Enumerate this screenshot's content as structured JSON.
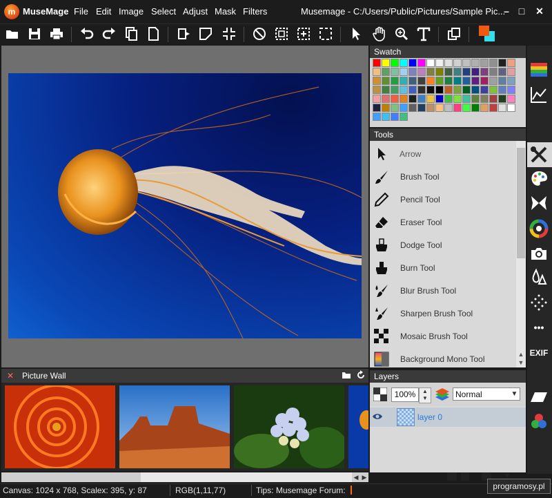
{
  "app": {
    "name": "MuseMage",
    "logo_letter": "m",
    "window_title": "Musemage - C:/Users/Public/Pictures/Sample Pic..."
  },
  "menu": [
    {
      "label": "File"
    },
    {
      "label": "Edit"
    },
    {
      "label": "Image"
    },
    {
      "label": "Select"
    },
    {
      "label": "Adjust"
    },
    {
      "label": "Mask"
    },
    {
      "label": "Filters"
    }
  ],
  "window_controls": {
    "minimize": "–",
    "maximize": "□",
    "close": "✕"
  },
  "toolbar": {
    "icons": [
      "open-folder-icon",
      "save-icon",
      "print-icon",
      "undo-icon",
      "redo-icon",
      "copy-icon",
      "paste-icon",
      "rotate-icon",
      "transform-icon",
      "crop-icon",
      "deselect-icon",
      "select-rect-icon",
      "select-all-icon",
      "select-dashed-icon",
      "arrow-cursor-icon",
      "hand-icon",
      "zoom-icon",
      "text-icon",
      "duplicate-icon",
      "color-swap-icon"
    ],
    "colors": {
      "foreground": "#f05a10",
      "background": "#30e0f0"
    }
  },
  "swatch": {
    "title": "Swatch",
    "colors": [
      "#ff0000",
      "#ffff00",
      "#00ff00",
      "#00ffff",
      "#0000ff",
      "#ff00ff",
      "#ffffff",
      "#f0f0f0",
      "#e0e0e0",
      "#d0d0d0",
      "#c0c0c0",
      "#b0b0b0",
      "#a0a0a0",
      "#909090",
      "#202020",
      "#f0a080",
      "#f0c080",
      "#60a060",
      "#80c0a0",
      "#a0d0f0",
      "#8080c0",
      "#c080c0",
      "#808040",
      "#808000",
      "#406040",
      "#408080",
      "#204080",
      "#402080",
      "#804080",
      "#808080",
      "#606080",
      "#e0a0a0",
      "#d09030",
      "#609030",
      "#20a040",
      "#30b0b0",
      "#406080",
      "#404040",
      "#ff8020",
      "#60a020",
      "#208040",
      "#008080",
      "#2060a0",
      "#602080",
      "#a02060",
      "#a0a0a0",
      "#6080a0",
      "#80a0c0",
      "#c09040",
      "#408040",
      "#40a060",
      "#60c0e0",
      "#4060c0",
      "#303030",
      "#101010",
      "#000000",
      "#c06020",
      "#80a040",
      "#006020",
      "#005080",
      "#4040a0",
      "#80c040",
      "#6080c0",
      "#8080ff",
      "#f0a0a0",
      "#e07070",
      "#f06040",
      "#e08020",
      "#202020",
      "#4080c0",
      "#f0c040",
      "#0000c0",
      "#40c040",
      "#80e040",
      "#40c0a0",
      "#608040",
      "#808060",
      "#a04040",
      "#204020",
      "#ff80c0",
      "#202040",
      "#c08000",
      "#80c080",
      "#40a0ff",
      "#606060",
      "#204060",
      "#c09060",
      "#ffc080",
      "#c0c0c0",
      "#ff4080",
      "#40ff40",
      "#008000",
      "#e0a060",
      "#c04040",
      "#e0e0e0",
      "#ffffff",
      "#40a0ff",
      "#40c0f0",
      "#4080ff",
      "#40c080"
    ]
  },
  "tools": {
    "title": "Tools",
    "items": [
      {
        "label": "Arrow",
        "icon": "arrow-cursor-icon"
      },
      {
        "label": "Brush Tool",
        "icon": "brush-icon"
      },
      {
        "label": "Pencil Tool",
        "icon": "pencil-icon"
      },
      {
        "label": "Eraser Tool",
        "icon": "eraser-icon"
      },
      {
        "label": "Dodge Tool",
        "icon": "dodge-icon"
      },
      {
        "label": "Burn Tool",
        "icon": "burn-icon"
      },
      {
        "label": "Blur Brush Tool",
        "icon": "blur-brush-icon"
      },
      {
        "label": "Sharpen Brush Tool",
        "icon": "sharpen-brush-icon"
      },
      {
        "label": "Mosaic Brush Tool",
        "icon": "mosaic-icon"
      },
      {
        "label": "Background Mono Tool",
        "icon": "background-mono-icon"
      }
    ]
  },
  "side_strip": {
    "icons": [
      "swatch-panel-icon",
      "histogram-icon",
      "tools-panel-icon",
      "palette-icon",
      "butterfly-icon",
      "color-wheel-icon",
      "camera-icon",
      "drops-icon",
      "sparkle-icon",
      "more-icon",
      "exif-icon",
      "layers-panel-icon",
      "channels-icon"
    ],
    "exif_label": "EXIF",
    "more_label": "•••"
  },
  "layers": {
    "title": "Layers",
    "opacity": "100%",
    "blend_mode": "Normal",
    "items": [
      {
        "name": "layer 0"
      }
    ]
  },
  "picture_wall": {
    "title": "Picture Wall",
    "close": "✕"
  },
  "status": {
    "canvas_info": "Canvas: 1024 x 768, Scalex: 395, y: 87",
    "color_info": "RGB(1,11,77)",
    "tips": "Tips: Musemage Forum:"
  },
  "watermark": "programosy.pl"
}
